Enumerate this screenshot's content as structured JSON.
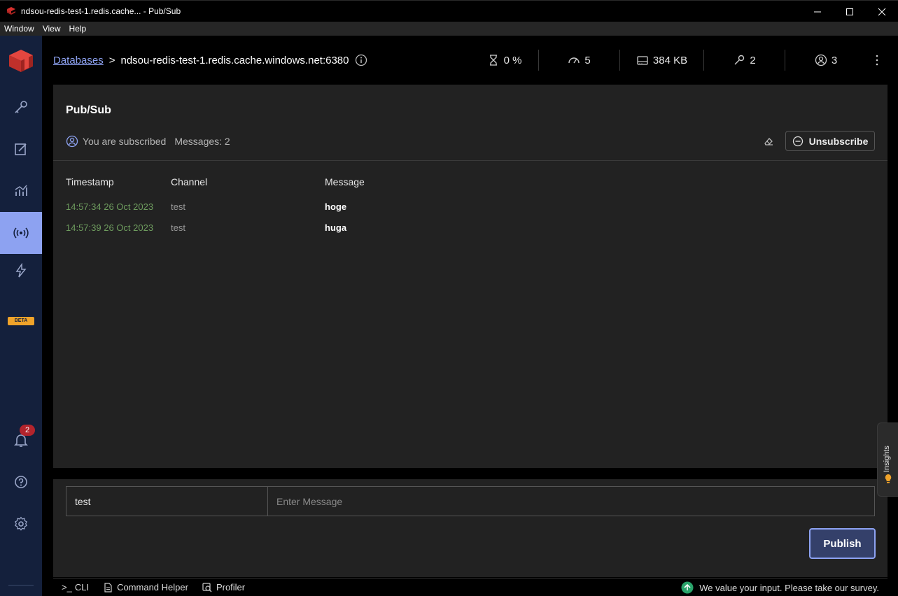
{
  "window": {
    "title": "ndsou-redis-test-1.redis.cache... - Pub/Sub"
  },
  "menu": [
    "Window",
    "View",
    "Help"
  ],
  "header": {
    "breadcrumb_link": "Databases",
    "breadcrumb_sep": ">",
    "database": "ndsou-redis-test-1.redis.cache.windows.net:6380",
    "stats": {
      "cpu": "0 %",
      "ops": "5",
      "memory": "384 KB",
      "keys": "2",
      "clients": "3"
    }
  },
  "pubsub": {
    "title": "Pub/Sub",
    "status": "You are subscribed",
    "messages": "Messages: 2",
    "unsubscribe_label": "Unsubscribe",
    "columns": [
      "Timestamp",
      "Channel",
      "Message"
    ],
    "rows": [
      {
        "timestamp": "14:57:34 26 Oct 2023",
        "channel": "test",
        "message": "hoge"
      },
      {
        "timestamp": "14:57:39 26 Oct 2023",
        "channel": "test",
        "message": "huga"
      }
    ]
  },
  "form": {
    "channel_value": "test",
    "message_placeholder": "Enter Message",
    "publish_label": "Publish"
  },
  "sidebar": {
    "beta_label": "BETA",
    "notification_count": "2"
  },
  "bottom": {
    "cli": "CLI",
    "cli_prompt": ">_",
    "command_helper": "Command Helper",
    "profiler": "Profiler",
    "survey": "We value your input. Please take our survey."
  },
  "insights": {
    "label": "Insights"
  },
  "colors": {
    "accent": "#8da2f1",
    "sidebar_bg": "#14203c",
    "panel_bg": "#222222",
    "timestamp": "#6e9c5e",
    "badge": "#b3242c"
  }
}
